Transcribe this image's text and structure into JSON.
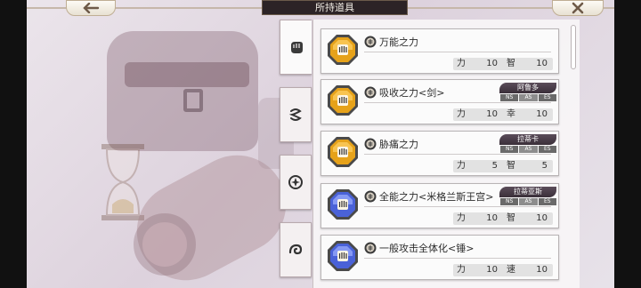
{
  "header": {
    "title": "所持道具"
  },
  "nav": {
    "back_icon": "arrow-left-icon",
    "close_icon": "close-icon"
  },
  "tabs": [
    {
      "icon": "fist-icon",
      "active": true
    },
    {
      "icon": "swirl-icon",
      "active": false
    },
    {
      "icon": "star-emblem-icon",
      "active": false
    },
    {
      "icon": "wave-icon",
      "active": false
    }
  ],
  "colors": {
    "gem_gold": "#e6a21a",
    "gem_blue": "#4a62d8",
    "badge": "#463a45"
  },
  "items": [
    {
      "name": "万能之力",
      "gem": "gold",
      "stats": [
        [
          "力",
          "10"
        ],
        [
          "智",
          "10"
        ]
      ],
      "badge": null
    },
    {
      "name": "吸收之力<剑>",
      "gem": "gold",
      "stats": [
        [
          "力",
          "10"
        ],
        [
          "幸",
          "10"
        ]
      ],
      "badge": {
        "name": "阿鲁多",
        "tags": [
          "NS",
          "AS",
          "ES"
        ]
      }
    },
    {
      "name": "胁痛之力",
      "gem": "gold",
      "stats": [
        [
          "力",
          "5"
        ],
        [
          "智",
          "5"
        ]
      ],
      "badge": {
        "name": "拉蒂卡",
        "tags": [
          "NS",
          "AS",
          "ES"
        ]
      }
    },
    {
      "name": "全能之力<米格兰斯王宫>",
      "gem": "blue",
      "stats": [
        [
          "力",
          "10"
        ],
        [
          "智",
          "10"
        ]
      ],
      "badge": {
        "name": "拉蒂亚斯",
        "tags": [
          "NS",
          "AS",
          "ES"
        ]
      }
    },
    {
      "name": "一般攻击全体化<锤>",
      "gem": "blue",
      "stats": [
        [
          "力",
          "10"
        ],
        [
          "速",
          "10"
        ]
      ],
      "badge": null
    }
  ]
}
